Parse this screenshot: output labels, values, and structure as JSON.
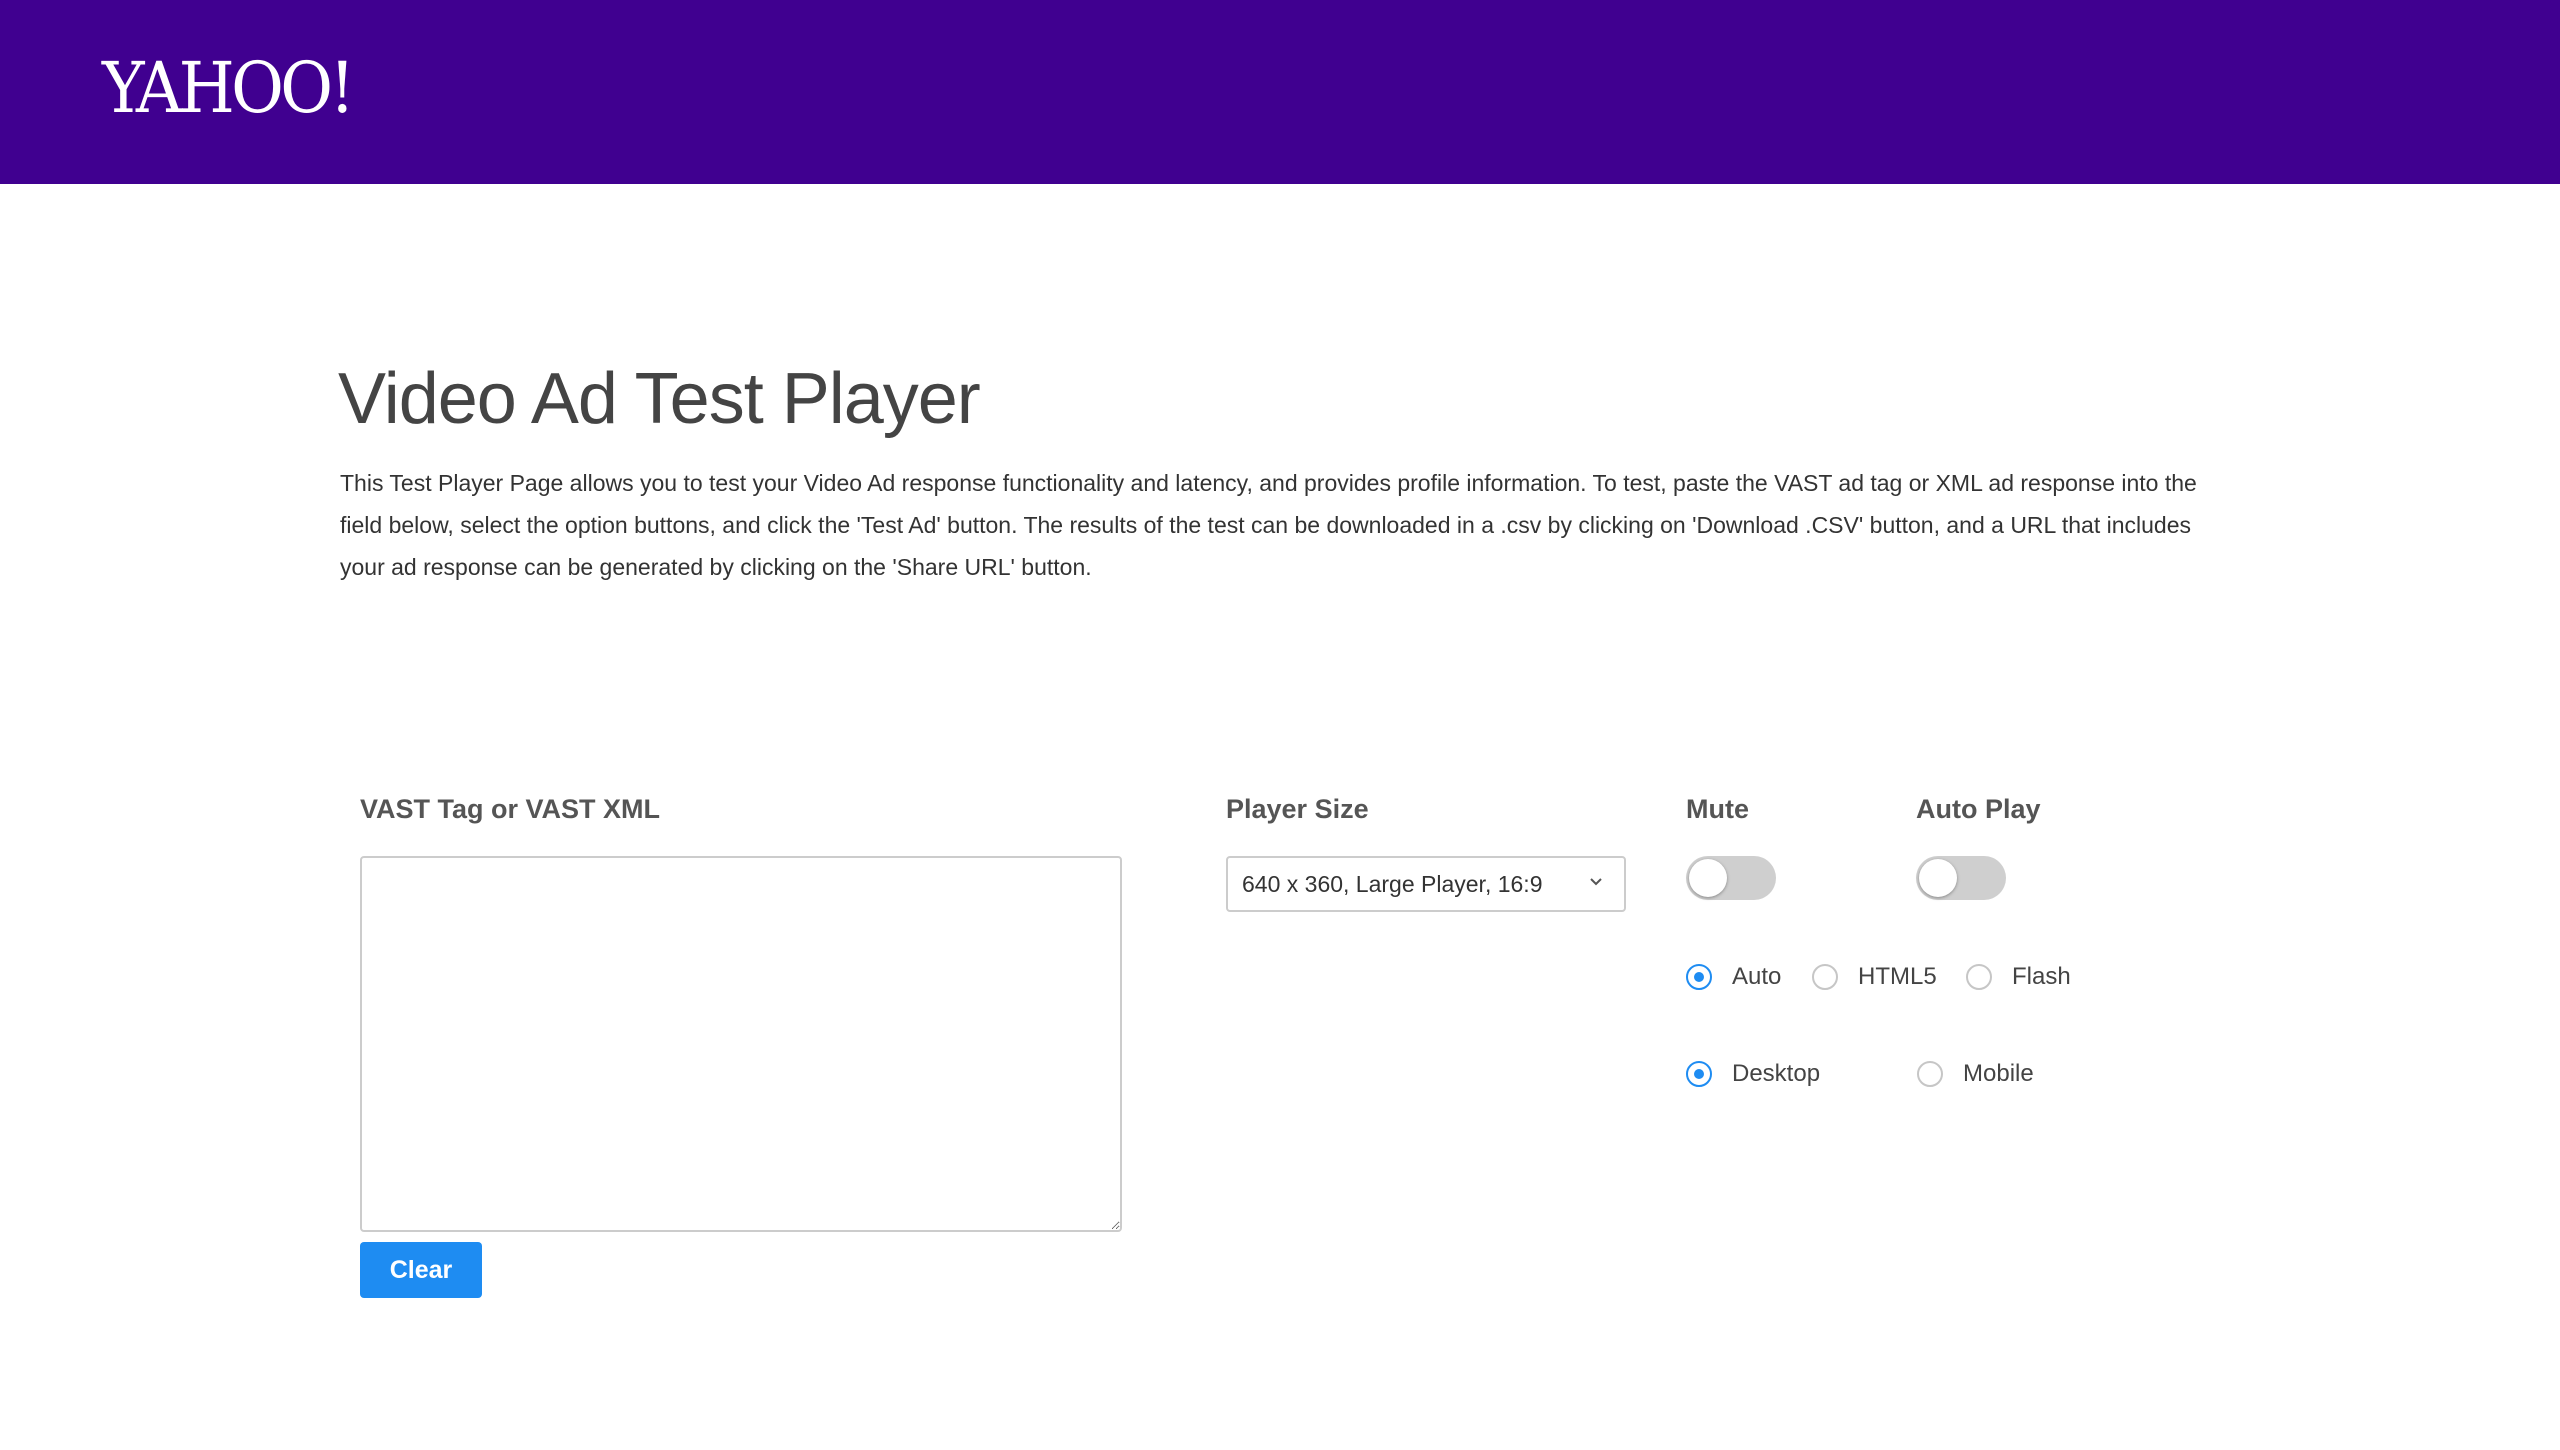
{
  "header": {
    "logo_text": "YAHOO!",
    "background_color": "#400090"
  },
  "main": {
    "title": "Video Ad Test Player",
    "description": "This Test Player Page allows you to test your Video Ad response functionality and latency, and provides profile information. To test, paste the VAST ad tag or XML ad response into the field below, select the option buttons, and click the 'Test Ad' button. The results of the test can be downloaded in a .csv by clicking on 'Download .CSV' button, and a URL that includes your ad response can be generated by clicking on the 'Share URL' button."
  },
  "form": {
    "vast_label": "VAST Tag or VAST XML",
    "vast_value": "",
    "clear_label": "Clear",
    "player_size_label": "Player Size",
    "player_size_selected": "640 x 360, Large Player, 16:9",
    "mute_label": "Mute",
    "mute_on": false,
    "autoplay_label": "Auto Play",
    "autoplay_on": false,
    "tech_options": [
      {
        "label": "Auto",
        "checked": true
      },
      {
        "label": "HTML5",
        "checked": false
      },
      {
        "label": "Flash",
        "checked": false
      }
    ],
    "device_options": [
      {
        "label": "Desktop",
        "checked": true
      },
      {
        "label": "Mobile",
        "checked": false
      }
    ]
  },
  "colors": {
    "accent": "#1e8cf2",
    "toggle_off": "#cfcfcf"
  },
  "icons": {
    "select_arrow": "chevron-down-icon"
  }
}
